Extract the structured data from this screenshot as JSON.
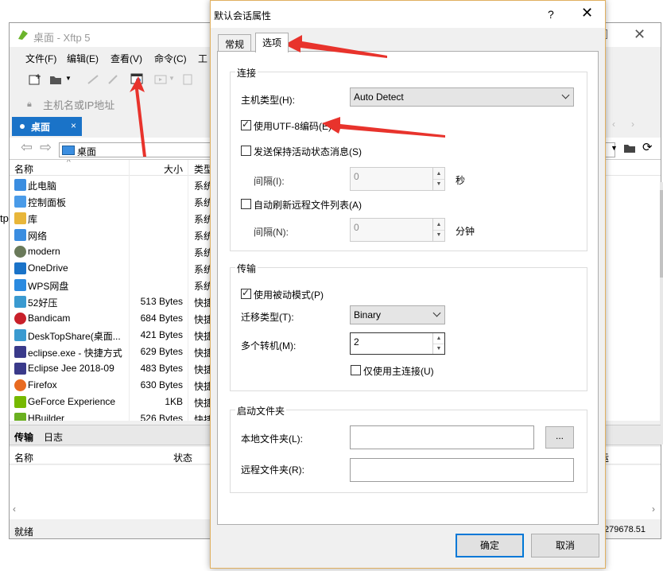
{
  "xftp": {
    "title": "桌面 - Xftp 5",
    "menu": [
      "文件(F)",
      "编辑(E)",
      "查看(V)",
      "命令(C)",
      "工"
    ],
    "address_placeholder": "主机名或IP地址",
    "tab_label": "桌面",
    "tab_close": "×",
    "path": "桌面",
    "columns": {
      "name": "名称",
      "size": "大小",
      "type": "类型"
    },
    "files": [
      {
        "name": "此电脑",
        "size": "",
        "type": "系统",
        "icon": "computer-icon"
      },
      {
        "name": "控制面板",
        "size": "",
        "type": "系统",
        "icon": "control-panel-icon"
      },
      {
        "name": "库",
        "size": "",
        "type": "系统",
        "icon": "library-icon"
      },
      {
        "name": "网络",
        "size": "",
        "type": "系统",
        "icon": "network-icon"
      },
      {
        "name": "modern",
        "size": "",
        "type": "系统",
        "icon": "user-icon"
      },
      {
        "name": "OneDrive",
        "size": "",
        "type": "系统",
        "icon": "onedrive-icon"
      },
      {
        "name": "WPS网盘",
        "size": "",
        "type": "系统",
        "icon": "wps-cloud-icon"
      },
      {
        "name": "52好压",
        "size": "513 Bytes",
        "type": "快捷",
        "icon": "app-icon"
      },
      {
        "name": "Bandicam",
        "size": "684 Bytes",
        "type": "快捷",
        "icon": "bandicam-icon"
      },
      {
        "name": "DeskTopShare(桌面...",
        "size": "421 Bytes",
        "type": "快捷",
        "icon": "app-icon"
      },
      {
        "name": "eclipse.exe - 快捷方式",
        "size": "629 Bytes",
        "type": "快捷",
        "icon": "eclipse-icon"
      },
      {
        "name": "Eclipse Jee 2018-09",
        "size": "483 Bytes",
        "type": "快捷",
        "icon": "eclipse-icon"
      },
      {
        "name": "Firefox",
        "size": "630 Bytes",
        "type": "快捷",
        "icon": "firefox-icon"
      },
      {
        "name": "GeForce Experience",
        "size": "1KB",
        "type": "快捷",
        "icon": "geforce-icon"
      },
      {
        "name": "HBuilder",
        "size": "526 Bytes",
        "type": "快捷",
        "icon": "hbuilder-icon"
      }
    ],
    "bottom_tabs": [
      "传输",
      "日志"
    ],
    "transfer_columns": {
      "name": "名称",
      "status": "状态",
      "extra": "运"
    },
    "status": "就绪",
    "status_right": "279678.51",
    "left_edge_text": "tp"
  },
  "dialog": {
    "title": "默认会话属性",
    "help": "?",
    "close": "✕",
    "tabs": [
      "常规",
      "选项"
    ],
    "connection": {
      "group_label": "连接",
      "host_type_label": "主机类型(H):",
      "host_type_value": "Auto Detect",
      "utf8_label": "使用UTF-8编码(E)",
      "utf8_checked": true,
      "keepalive_label": "发送保持活动状态消息(S)",
      "keepalive_checked": false,
      "interval1_label": "间隔(I):",
      "interval1_value": "0",
      "interval1_unit": "秒",
      "autorefresh_label": "自动刷新远程文件列表(A)",
      "autorefresh_checked": false,
      "interval2_label": "间隔(N):",
      "interval2_value": "0",
      "interval2_unit": "分钟"
    },
    "transfer": {
      "group_label": "传输",
      "passive_label": "使用被动模式(P)",
      "passive_checked": true,
      "mode_label": "迁移类型(T):",
      "mode_value": "Binary",
      "multi_label": "多个转机(M):",
      "multi_value": "2",
      "primary_only_label": "仅使用主连接(U)",
      "primary_only_checked": false
    },
    "startup": {
      "group_label": "启动文件夹",
      "local_label": "本地文件夹(L):",
      "local_value": "",
      "browse": "...",
      "remote_label": "远程文件夹(R):",
      "remote_value": ""
    },
    "ok": "确定",
    "cancel": "取消"
  },
  "colors": {
    "accent": "#1a73c8",
    "arrow": "#e8332c",
    "dialog_border": "#e0b060"
  }
}
